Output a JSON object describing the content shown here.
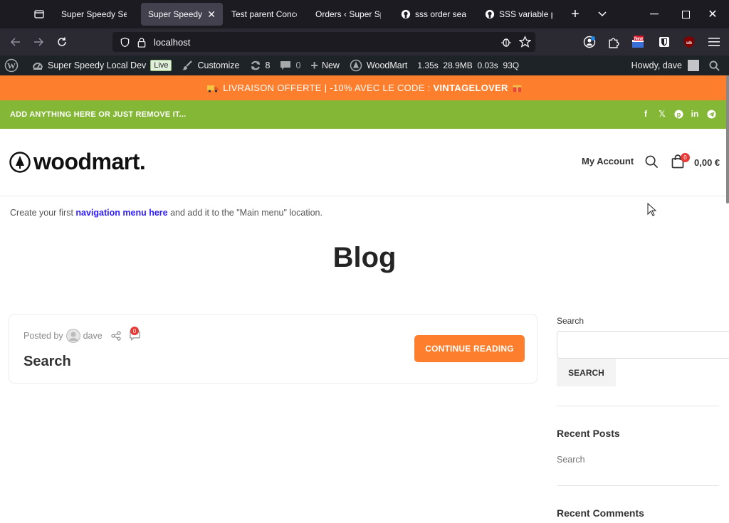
{
  "browser": {
    "tabs": [
      {
        "label": "Super Speedy Search"
      },
      {
        "label": "Super Speedy Local",
        "active": true
      },
      {
        "label": "Test parent Concept"
      },
      {
        "label": "Orders ‹ Super Speedy"
      },
      {
        "label": "sss order search"
      },
      {
        "label": "SSS variable prod"
      }
    ],
    "url": "localhost"
  },
  "adminbar": {
    "site_name": "Super Speedy Local Dev",
    "live": "Live",
    "customize": "Customize",
    "updates": "8",
    "comments": "0",
    "new": "New",
    "theme": "WoodMart",
    "perf": "1.35s  28.9MB  0.03s  93Q",
    "howdy": "Howdy, dave"
  },
  "promo": {
    "text": "LIVRAISON OFFERTE | -10% AVEC LE CODE :",
    "code": "VINTAGELOVER"
  },
  "topbar": {
    "text": "ADD ANYTHING HERE OR JUST REMOVE IT..."
  },
  "header": {
    "logo": "woodmart.",
    "my_account": "My Account",
    "cart_count": "0",
    "cart_total": "0,00 €"
  },
  "navmsg": {
    "prefix": "Create your first",
    "link": "navigation menu here",
    "suffix": "and add it to the \"Main menu\" location."
  },
  "page": {
    "title": "Blog"
  },
  "post": {
    "posted_by": "Posted by",
    "author": "dave",
    "comment_count": "0",
    "title": "Search",
    "continue": "CONTINUE READING"
  },
  "sidebar": {
    "search_label": "Search",
    "search_button": "SEARCH",
    "recent_posts": "Recent Posts",
    "recent_post_item": "Search",
    "recent_comments": "Recent Comments"
  },
  "colors": {
    "orange": "#fd7e2c",
    "green": "#83b735",
    "admin": "#1d2327",
    "link": "#2d1bff"
  }
}
